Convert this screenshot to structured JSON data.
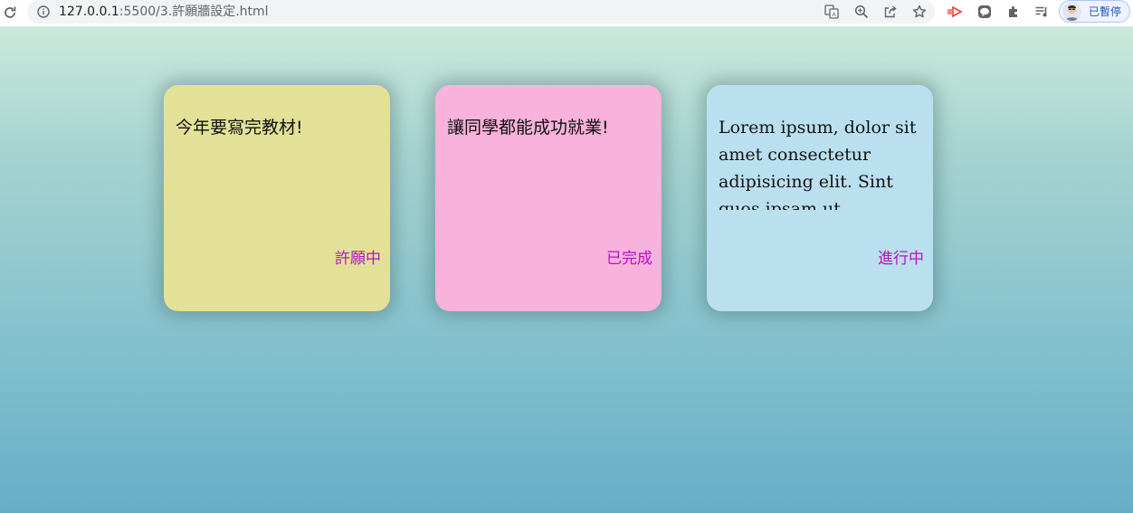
{
  "browser": {
    "url_host": "127.0.0.1",
    "url_rest": ":5500/3.許願牆設定.html",
    "profile_label": "已暫停",
    "icons": [
      "reload-icon",
      "info-icon",
      "translate-icon",
      "zoom-icon",
      "share-icon",
      "star-icon",
      "extension-red-icon",
      "line-icon",
      "puzzle-icon",
      "reading-list-icon"
    ]
  },
  "page": {
    "background_top": "#cbe9dc",
    "background_bottom": "#66aec7",
    "status_color": "#b515c6"
  },
  "cards": [
    {
      "text": "今年要寫完教材!",
      "status": "許願中",
      "color": "#e3e197"
    },
    {
      "text": "讓同學都能成功就業!",
      "status": "已完成",
      "color": "#f8b2dc"
    },
    {
      "text": "Lorem ipsum, dolor sit amet consectetur adipisicing elit. Sint quos ipsam ut",
      "status": "進行中",
      "color": "#bae0ef"
    }
  ]
}
